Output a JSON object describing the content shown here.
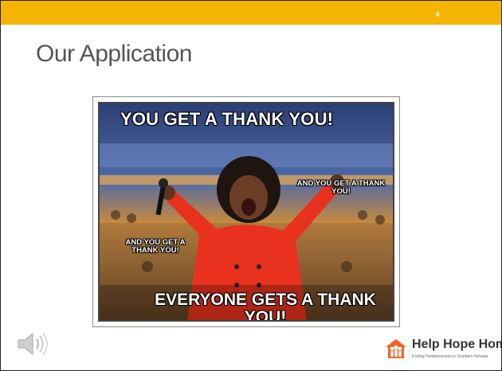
{
  "slide": {
    "page_number": "4",
    "title": "Our Application"
  },
  "meme": {
    "top_caption": "YOU GET A THANK YOU!",
    "right_caption": "AND YOU GET A THANK YOU!",
    "left_caption": "AND YOU GET A THANK YOU!",
    "bottom_caption": "EVERYONE GETS A THANK YOU!"
  },
  "audio": {
    "icon": "speaker-icon"
  },
  "logo": {
    "name": "Help Hope Home",
    "tagline": "Ending Homelessness in Southern Nevada",
    "icon": "people-house-icon"
  },
  "colors": {
    "top_bar": "#f4b400",
    "title_text": "#555555",
    "logo_accent": "#f26522"
  }
}
